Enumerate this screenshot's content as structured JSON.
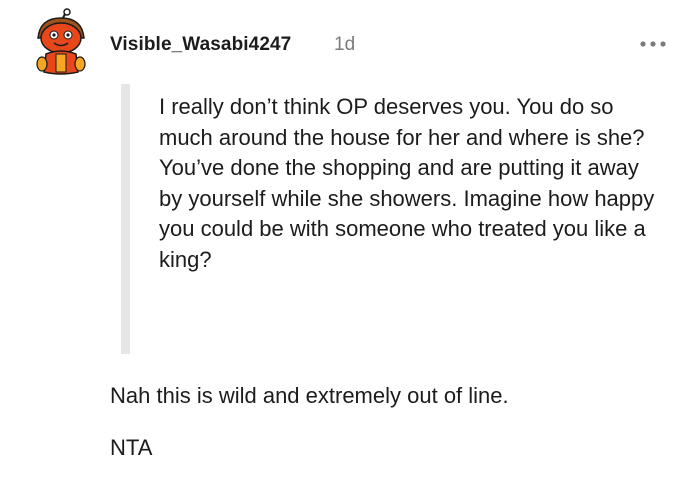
{
  "comment": {
    "username": "Visible_Wasabi4247",
    "age": "1d",
    "avatar_icon": "snoo-avatar-icon",
    "more_icon": "more-options-icon",
    "quote": "I really don’t think OP deserves you. You do so much around the house for her and where is she? You’ve done the shopping and are putting it away by yourself while she showers. Imagine how happy you could be with someone who treated you like a king?",
    "reply_lines": [
      "Nah this is wild and extremely out of line.",
      "NTA"
    ]
  },
  "colors": {
    "username": "#1c1c1c",
    "age": "#7c7c7c",
    "quote_bar": "#e6e6e6",
    "avatar_primary": "#e8471c",
    "avatar_accent": "#f5a623"
  }
}
